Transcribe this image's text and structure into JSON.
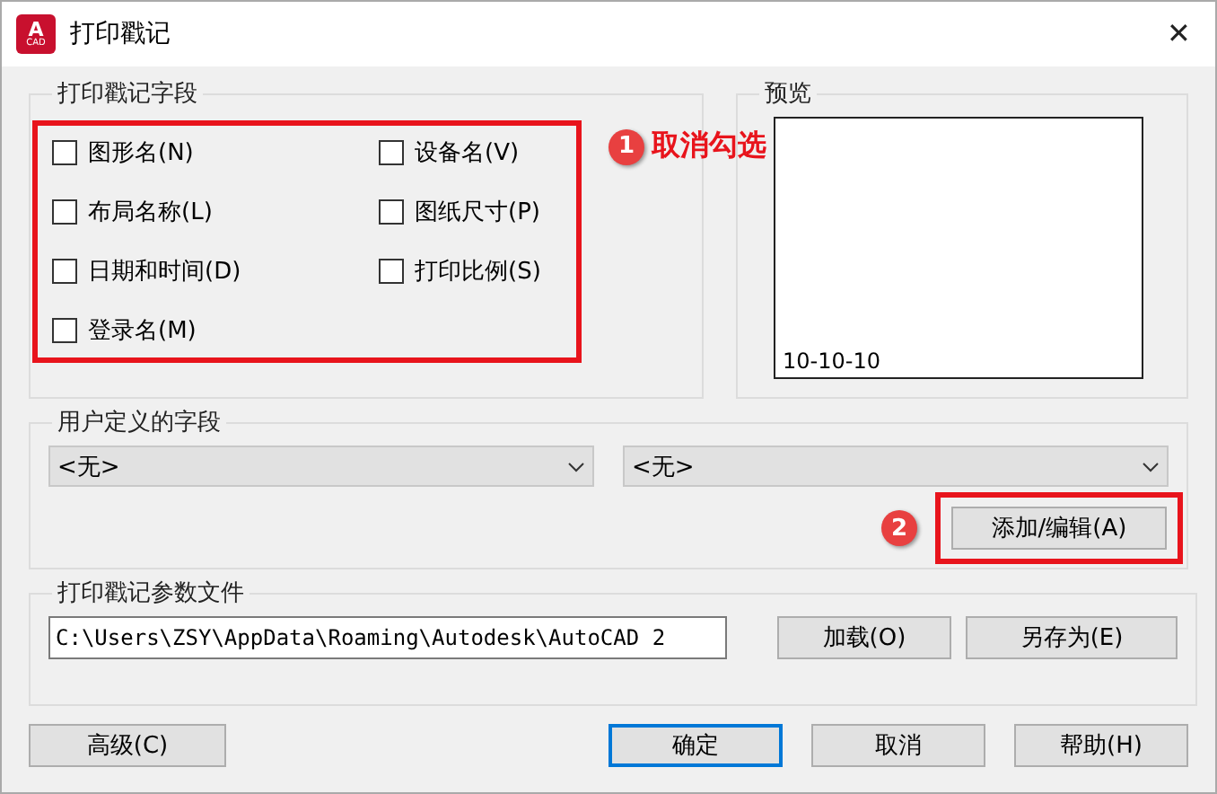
{
  "window": {
    "title": "打印戳记",
    "logo_text": "A",
    "logo_subtext": "CAD",
    "close": "✕"
  },
  "stamp_fields": {
    "title": "打印戳记字段",
    "items": [
      {
        "label": "图形名(N)",
        "checked": false
      },
      {
        "label": "设备名(V)",
        "checked": false
      },
      {
        "label": "布局名称(L)",
        "checked": false
      },
      {
        "label": "图纸尺寸(P)",
        "checked": false
      },
      {
        "label": "日期和时间(D)",
        "checked": false
      },
      {
        "label": "打印比例(S)",
        "checked": false
      },
      {
        "label": "登录名(M)",
        "checked": false
      }
    ]
  },
  "preview": {
    "title": "预览",
    "text": "10-10-10"
  },
  "user_fields": {
    "title": "用户定义的字段",
    "dropdowns": [
      "<无>",
      "<无>"
    ],
    "button": "添加/编辑(A)"
  },
  "param_file": {
    "title": "打印戳记参数文件",
    "path": "C:\\Users\\ZSY\\AppData\\Roaming\\Autodesk\\AutoCAD 2",
    "buttons": [
      "加载(O)",
      "另存为(E)"
    ]
  },
  "footer": {
    "buttons": [
      {
        "label": "高级(C)",
        "default": false
      },
      {
        "label": "确定",
        "default": true
      },
      {
        "label": "取消",
        "default": false
      },
      {
        "label": "帮助(H)",
        "default": false
      }
    ]
  },
  "annotations": [
    {
      "number": "1",
      "text": "取消勾选"
    },
    {
      "number": "2"
    }
  ]
}
